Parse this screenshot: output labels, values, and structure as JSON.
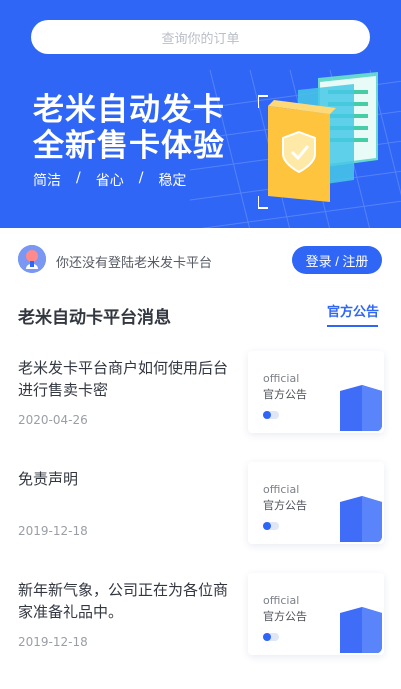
{
  "hero": {
    "search_placeholder": "查询你的订单",
    "title_line1": "老米自动发卡",
    "title_line2": "全新售卡体验",
    "features": [
      "简洁",
      "省心",
      "稳定"
    ],
    "separator": "/",
    "bg_color": "#2f66f6"
  },
  "login": {
    "message": "你还没有登陆老米发卡平台",
    "button_label": "登录 / 注册",
    "avatar_icon": "user-avatar-icon"
  },
  "section": {
    "title": "老米自动卡平台消息",
    "tab_label": "官方公告"
  },
  "news": [
    {
      "title": "老米发卡平台商户如何使用后台进行售卖卡密",
      "date": "2020-04-26",
      "card_en": "official",
      "card_cn": "官方公告"
    },
    {
      "title": "免责声明",
      "date": "2019-12-18",
      "card_en": "official",
      "card_cn": "官方公告"
    },
    {
      "title": "新年新气象，公司正在为各位商家准备礼品中。",
      "date": "2019-12-18",
      "card_en": "official",
      "card_cn": "官方公告"
    }
  ],
  "colors": {
    "accent": "#2f66f6",
    "text_dark": "#333740",
    "text_muted": "#9a9ea6"
  }
}
